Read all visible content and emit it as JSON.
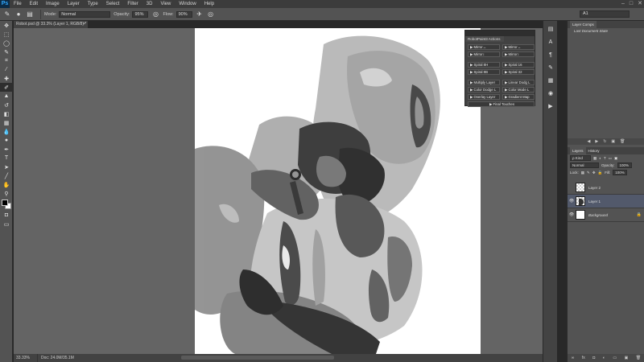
{
  "app": {
    "logo": "Ps"
  },
  "menu": [
    "File",
    "Edit",
    "Image",
    "Layer",
    "Type",
    "Select",
    "Filter",
    "3D",
    "View",
    "Window",
    "Help"
  ],
  "window_controls": [
    "–",
    "□",
    "✕"
  ],
  "options_bar": {
    "mode_label": "Mode:",
    "mode_value": "Normal",
    "opacity_label": "Opacity:",
    "opacity_value": "95%",
    "flow_label": "Flow:",
    "flow_value": "90%",
    "workspace": "A1"
  },
  "document": {
    "tab_title": "Robot.psd @ 33.3% (Layer 1, RGB/8) *",
    "close": "×"
  },
  "actions_panel": {
    "title": "RobotPaint3 Actions",
    "buttons": [
      [
        "▶ Mirror↔",
        "▶ Mirror↔"
      ],
      [
        "▶ Mirror↕",
        "▶ Mirror↕"
      ],
      [
        "▶ Spiral 8H",
        "▶ Spiral 16"
      ],
      [
        "▶ Spiral 8B",
        "▶ Spiral 32"
      ],
      [
        "▶ Multiply Layer",
        "▶ Linear Dodg L"
      ],
      [
        "▶ Color Dodge L",
        "▶ Color Mode L"
      ],
      [
        "▶ Overlay Layer",
        "▶ Gradient Map"
      ]
    ],
    "final": "▶ Final Touches"
  },
  "layer_comps": {
    "tab": "Layer Comps",
    "item": "Last Document State"
  },
  "layers_panel": {
    "tabs": [
      "Layers",
      "History"
    ],
    "kind": "ρ Kind",
    "blend": "Normal",
    "opacity_label": "Opacity:",
    "opacity_value": "100%",
    "lock_label": "Lock:",
    "fill_label": "Fill:",
    "fill_value": "100%",
    "layers": [
      {
        "name": "Layer 2",
        "visible": false,
        "selected": false
      },
      {
        "name": "Layer 1",
        "visible": true,
        "selected": true
      },
      {
        "name": "Background",
        "visible": true,
        "selected": false
      }
    ]
  },
  "status": {
    "zoom": "33.33%",
    "doc": "Doc: 24.0M/35.1M"
  }
}
